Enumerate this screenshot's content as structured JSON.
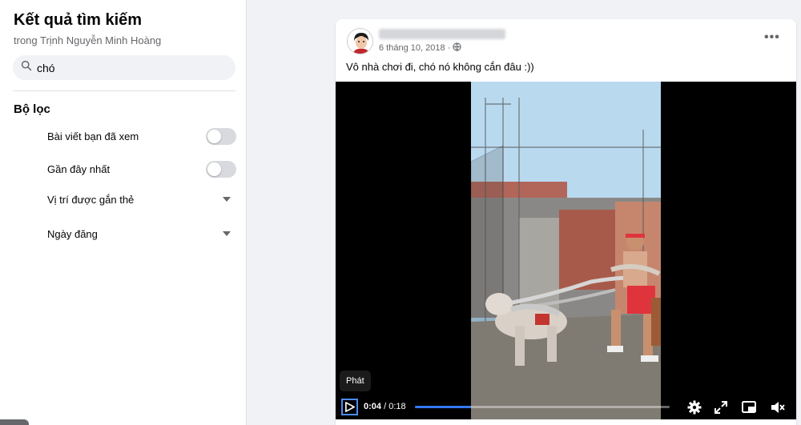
{
  "sidebar": {
    "title": "Kết quả tìm kiếm",
    "subtitle": "trong Trịnh Nguyễn Minh Hoàng",
    "search_value": "chó",
    "filters_heading": "Bộ lọc",
    "filters": [
      {
        "label": "Bài viết bạn đã xem",
        "control": "toggle",
        "on": false
      },
      {
        "label": "Gần đây nhất",
        "control": "toggle",
        "on": false
      },
      {
        "label": "Vị trí được gắn thẻ",
        "control": "dropdown"
      },
      {
        "label": "Ngày đăng",
        "control": "dropdown"
      }
    ]
  },
  "post": {
    "date": "6 tháng 10, 2018 ·",
    "privacy_icon": "globe-icon",
    "caption": "Vô nhà chơi đi, chó nó không cắn đâu :))",
    "video": {
      "tooltip": "Phát",
      "current_time": "0:04",
      "duration": "/ 0:18",
      "progress": 0.22
    }
  },
  "colors": {
    "accent": "#3478f6",
    "toggle_off": "#d8dadf",
    "secondary_text": "#65676b"
  }
}
